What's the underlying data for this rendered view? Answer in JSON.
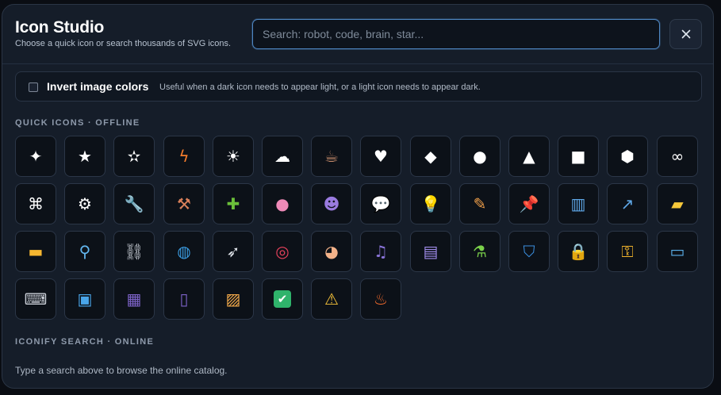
{
  "header": {
    "title": "Icon Studio",
    "subtitle": "Choose a quick icon or search thousands of SVG icons.",
    "search_placeholder": "Search: robot, code, brain, star..."
  },
  "invert": {
    "label": "Invert image colors",
    "help": "Useful when a dark icon needs to appear light, or a light icon needs to appear dark.",
    "checked": false
  },
  "quick_icons": {
    "title": "QUICK ICONS · OFFLINE",
    "items": [
      {
        "name": "sparkle",
        "glyph": "✦",
        "color": "#ffffff"
      },
      {
        "name": "star-filled",
        "glyph": "★",
        "color": "#ffffff"
      },
      {
        "name": "star-outline",
        "glyph": "✫",
        "color": "#ffffff"
      },
      {
        "name": "lightning",
        "glyph": "ϟ",
        "color": "#f47c2c"
      },
      {
        "name": "sun",
        "glyph": "☀",
        "color": "#ffffff"
      },
      {
        "name": "cloud",
        "glyph": "☁",
        "color": "#ffffff"
      },
      {
        "name": "coffee",
        "glyph": "☕",
        "color": "#c58a6a"
      },
      {
        "name": "heart",
        "glyph": "♥",
        "color": "#ffffff"
      },
      {
        "name": "diamond",
        "glyph": "◆",
        "color": "#ffffff"
      },
      {
        "name": "circle",
        "glyph": "●",
        "color": "#ffffff"
      },
      {
        "name": "triangle",
        "glyph": "▲",
        "color": "#ffffff"
      },
      {
        "name": "square",
        "glyph": "■",
        "color": "#ffffff"
      },
      {
        "name": "hexagon",
        "glyph": "⬢",
        "color": "#ffffff"
      },
      {
        "name": "infinity",
        "glyph": "∞",
        "color": "#ffffff"
      },
      {
        "name": "command",
        "glyph": "⌘",
        "color": "#ffffff"
      },
      {
        "name": "gear",
        "glyph": "⚙",
        "color": "#ffffff"
      },
      {
        "name": "wrench",
        "glyph": "🔧",
        "color": "#aeb6c2"
      },
      {
        "name": "tools",
        "glyph": "⚒",
        "color": "#d9805a"
      },
      {
        "name": "puzzle",
        "glyph": "✚",
        "color": "#6bbf3a"
      },
      {
        "name": "brain",
        "glyph": "●",
        "color": "#ef8ab8"
      },
      {
        "name": "robot",
        "glyph": "☻",
        "color": "#9a7be0"
      },
      {
        "name": "speech-bubble",
        "glyph": "💬",
        "color": "#e9edf3"
      },
      {
        "name": "lightbulb",
        "glyph": "💡",
        "color": "#ffcc33"
      },
      {
        "name": "memo",
        "glyph": "✎",
        "color": "#f2a14a"
      },
      {
        "name": "pushpin",
        "glyph": "📌",
        "color": "#e8365d"
      },
      {
        "name": "bar-chart",
        "glyph": "▥",
        "color": "#5fa8e8"
      },
      {
        "name": "line-chart",
        "glyph": "↗",
        "color": "#5fa8e8"
      },
      {
        "name": "folder-tabs",
        "glyph": "▰",
        "color": "#f6c83a"
      },
      {
        "name": "folder",
        "glyph": "▬",
        "color": "#f6b730"
      },
      {
        "name": "magnifier",
        "glyph": "⚲",
        "color": "#62b6ef"
      },
      {
        "name": "link",
        "glyph": "⛓",
        "color": "#c8cdd5"
      },
      {
        "name": "globe",
        "glyph": "◍",
        "color": "#3a9be0"
      },
      {
        "name": "rocket",
        "glyph": "➶",
        "color": "#e0e4ea"
      },
      {
        "name": "target",
        "glyph": "◎",
        "color": "#e8425c"
      },
      {
        "name": "palette",
        "glyph": "◕",
        "color": "#f4b38a"
      },
      {
        "name": "music",
        "glyph": "♫",
        "color": "#8a74d8"
      },
      {
        "name": "clapperboard",
        "glyph": "▤",
        "color": "#9f8be8"
      },
      {
        "name": "test-tube",
        "glyph": "⚗",
        "color": "#7ad04a"
      },
      {
        "name": "shield",
        "glyph": "⛉",
        "color": "#3b8fe0"
      },
      {
        "name": "lock",
        "glyph": "🔒",
        "color": "#f2b42c"
      },
      {
        "name": "key",
        "glyph": "⚿",
        "color": "#f2b42c"
      },
      {
        "name": "laptop",
        "glyph": "▭",
        "color": "#5ab0ea"
      },
      {
        "name": "keyboard",
        "glyph": "⌨",
        "color": "#c9ced6"
      },
      {
        "name": "desktop",
        "glyph": "▣",
        "color": "#4aa6ea"
      },
      {
        "name": "calculator",
        "glyph": "▦",
        "color": "#7d63c8"
      },
      {
        "name": "file-cabinet",
        "glyph": "▯",
        "color": "#7d63c8"
      },
      {
        "name": "card-file-box",
        "glyph": "▨",
        "color": "#f2a94a"
      },
      {
        "name": "check-box",
        "glyph": "✔",
        "color": "#ffffff"
      },
      {
        "name": "warning",
        "glyph": "⚠",
        "color": "#f6c33a"
      },
      {
        "name": "fire",
        "glyph": "♨",
        "color": "#f26a2c"
      }
    ]
  },
  "iconify": {
    "title": "ICONIFY SEARCH · ONLINE",
    "hint": "Type a search above to browse the online catalog."
  },
  "close_icon": "close-icon"
}
